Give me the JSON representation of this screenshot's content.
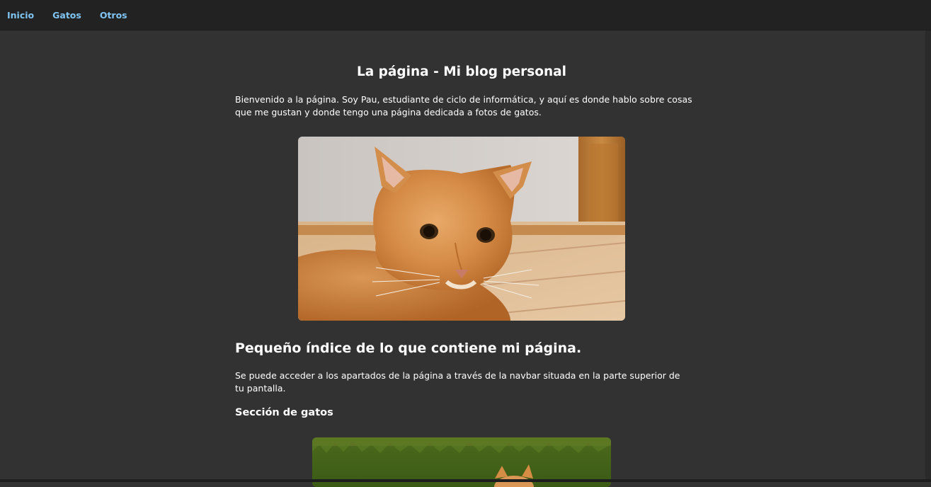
{
  "nav": {
    "items": [
      {
        "label": "Inicio"
      },
      {
        "label": "Gatos"
      },
      {
        "label": "Otros"
      }
    ]
  },
  "main": {
    "title": "La página - Mi blog personal",
    "intro": "Bienvenido a la página. Soy Pau, estudiante de ciclo de informática, y aquí es donde hablo sobre cosas que me gustan y donde tengo una página dedicada a fotos de gatos.",
    "index_title": "Pequeño índice de lo que contiene mi página.",
    "index_text": "Se puede acceder a los apartados de la página a través de la navbar situada en la parte superior de tu pantalla.",
    "cats_section_title": "Sección de gatos"
  },
  "colors": {
    "background": "#323232",
    "navbar": "#222222",
    "nav_link": "#7fc4f2",
    "text": "#ffffff"
  }
}
